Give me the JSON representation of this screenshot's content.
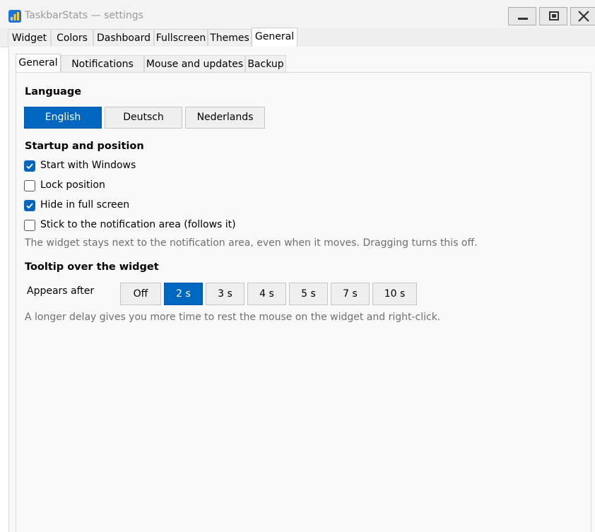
{
  "window": {
    "title": "TaskbarStats — settings",
    "controls": {
      "minimize": "minimize",
      "maximize": "maximize",
      "close": "close"
    }
  },
  "outer_tabs": [
    {
      "label": "Widget"
    },
    {
      "label": "Colors"
    },
    {
      "label": "Dashboard"
    },
    {
      "label": "Fullscreen"
    },
    {
      "label": "Themes"
    },
    {
      "label": "General",
      "active": true
    }
  ],
  "inner_tabs": [
    {
      "label": "General",
      "active": true
    },
    {
      "label": "Notifications"
    },
    {
      "label": "Mouse and updates"
    },
    {
      "label": "Backup"
    }
  ],
  "language": {
    "title": "Language",
    "options": [
      "English",
      "Deutsch",
      "Nederlands"
    ],
    "selected": "English"
  },
  "startup": {
    "title": "Startup and position",
    "checkboxes": [
      {
        "label": "Start with Windows",
        "checked": true
      },
      {
        "label": "Lock position",
        "checked": false
      },
      {
        "label": "Hide in full screen",
        "checked": true
      },
      {
        "label": "Stick to the notification area (follows it)",
        "checked": false
      }
    ],
    "hint": "The widget stays next to the notification area, even when it moves. Dragging turns this off."
  },
  "tooltip": {
    "title": "Tooltip over the widget",
    "label": "Appears after",
    "options": [
      "Off",
      "2 s",
      "3 s",
      "4 s",
      "5 s",
      "7 s",
      "10 s"
    ],
    "selected": "2 s",
    "hint": "A longer delay gives you more time to rest the mouse on the widget and right-click."
  },
  "colors": {
    "accent": "#0067c0",
    "hint_text": "#6f6f6f",
    "title_text": "#9a9a9a"
  }
}
